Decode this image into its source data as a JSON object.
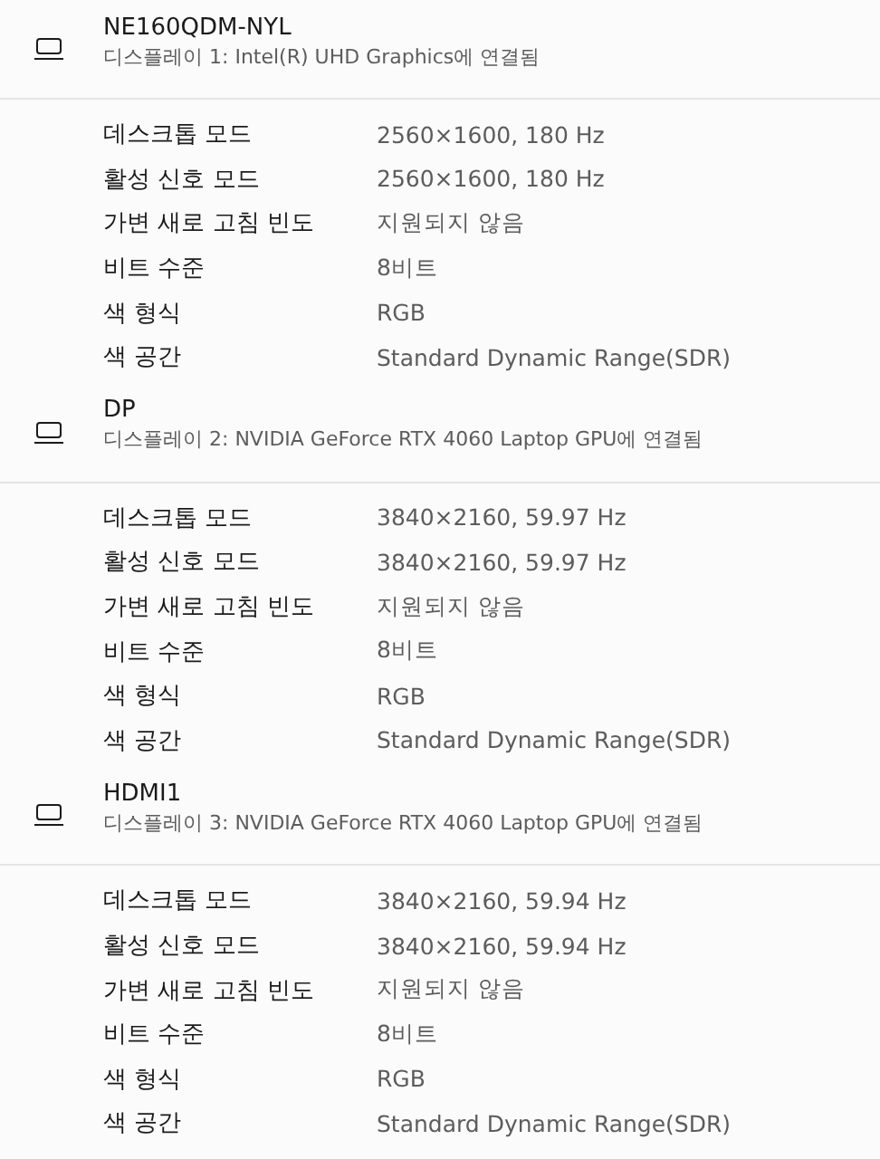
{
  "displays": [
    {
      "name": "NE160QDM-NYL",
      "connection": "디스플레이 1: Intel(R) UHD Graphics에 연결됨",
      "properties": [
        {
          "label": "데스크톱 모드",
          "value": "2560×1600, 180 Hz"
        },
        {
          "label": "활성 신호 모드",
          "value": "2560×1600, 180 Hz"
        },
        {
          "label": "가변 새로 고침 빈도",
          "value": "지원되지 않음"
        },
        {
          "label": "비트 수준",
          "value": "8비트"
        },
        {
          "label": "색 형식",
          "value": "RGB"
        },
        {
          "label": "색 공간",
          "value": "Standard Dynamic Range(SDR)"
        }
      ]
    },
    {
      "name": "DP",
      "connection": "디스플레이 2: NVIDIA GeForce RTX 4060 Laptop GPU에 연결됨",
      "properties": [
        {
          "label": "데스크톱 모드",
          "value": "3840×2160, 59.97 Hz"
        },
        {
          "label": "활성 신호 모드",
          "value": "3840×2160, 59.97 Hz"
        },
        {
          "label": "가변 새로 고침 빈도",
          "value": "지원되지 않음"
        },
        {
          "label": "비트 수준",
          "value": "8비트"
        },
        {
          "label": "색 형식",
          "value": "RGB"
        },
        {
          "label": "색 공간",
          "value": "Standard Dynamic Range(SDR)"
        }
      ]
    },
    {
      "name": "HDMI1",
      "connection": "디스플레이 3: NVIDIA GeForce RTX 4060 Laptop GPU에 연결됨",
      "properties": [
        {
          "label": "데스크톱 모드",
          "value": "3840×2160, 59.94 Hz"
        },
        {
          "label": "활성 신호 모드",
          "value": "3840×2160, 59.94 Hz"
        },
        {
          "label": "가변 새로 고침 빈도",
          "value": "지원되지 않음"
        },
        {
          "label": "비트 수준",
          "value": "8비트"
        },
        {
          "label": "색 형식",
          "value": "RGB"
        },
        {
          "label": "색 공간",
          "value": "Standard Dynamic Range(SDR)"
        }
      ]
    }
  ]
}
